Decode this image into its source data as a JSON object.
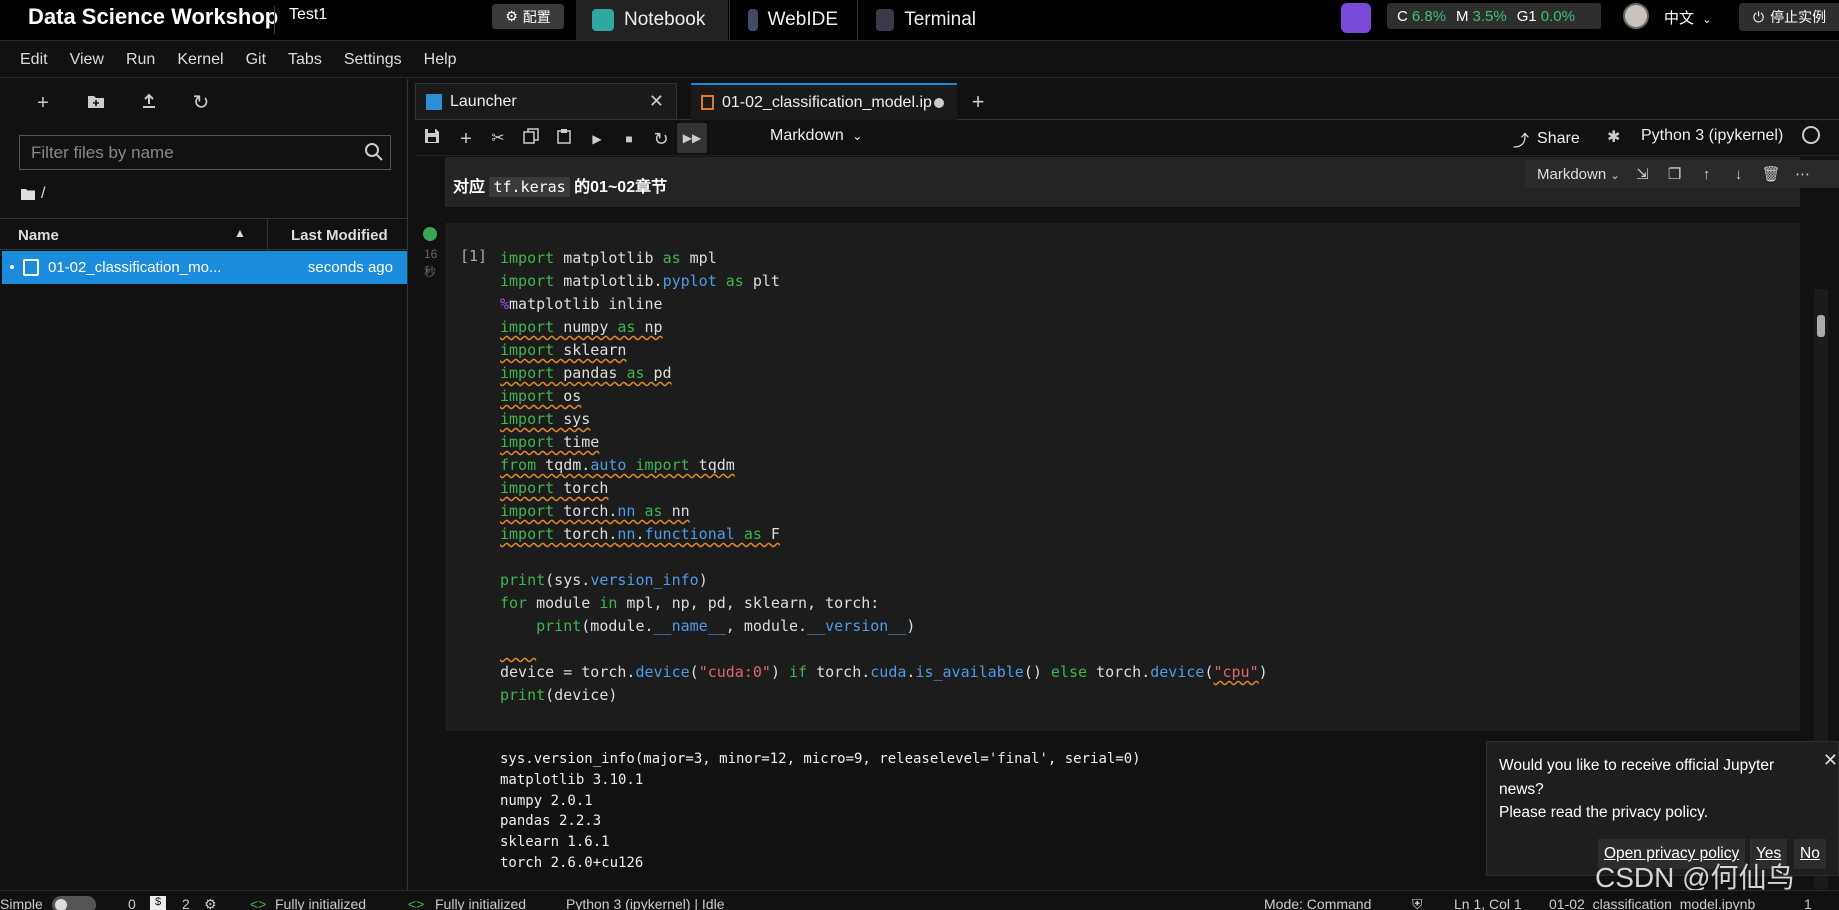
{
  "topbar": {
    "brand": "Data Science Workshop",
    "project": "Test1",
    "config_label": "配置",
    "tabs": [
      {
        "label": "Notebook",
        "icon": "notebook-icon",
        "color": "#2fa8a0"
      },
      {
        "label": "WebIDE",
        "icon": "webide-icon",
        "color": "#444a66"
      },
      {
        "label": "Terminal",
        "icon": "terminal-icon",
        "color": "#3a3a4a"
      }
    ],
    "resources": [
      {
        "label": "C",
        "value": "6.8%"
      },
      {
        "label": "M",
        "value": "3.5%"
      },
      {
        "label": "G1",
        "value": "0.0%"
      }
    ],
    "language": "中文",
    "stop_label": "停止实例"
  },
  "menu": [
    "Edit",
    "View",
    "Run",
    "Kernel",
    "Git",
    "Tabs",
    "Settings",
    "Help"
  ],
  "sidebar": {
    "filter_placeholder": "Filter files by name",
    "breadcrumb": "/",
    "col_name": "Name",
    "col_modified": "Last Modified",
    "files": [
      {
        "name": "01-02_classification_mo...",
        "modified": "seconds ago"
      }
    ]
  },
  "tabs": {
    "launcher": "Launcher",
    "notebook": "01-02_classification_model.ip"
  },
  "toolbar": {
    "cell_type": "Markdown",
    "share": "Share",
    "kernel": "Python 3 (ipykernel)"
  },
  "cell_toolbar": {
    "cell_type": "Markdown"
  },
  "markdown_cell": {
    "prefix": "对应 ",
    "code": "tf.keras",
    "suffix": " 的01~02章节"
  },
  "code_cell": {
    "prompt": "[1]",
    "time": "16",
    "time_unit": "秒"
  },
  "output": [
    "sys.version_info(major=3, minor=12, micro=9, releaselevel='final', serial=0)",
    "matplotlib 3.10.1",
    "numpy 2.0.1",
    "pandas 2.2.3",
    "sklearn 1.6.1",
    "torch 2.6.0+cu126"
  ],
  "notification": {
    "question": "Would you like to receive official Jupyter news?",
    "policy": "Please read the privacy policy.",
    "open_policy": "Open privacy policy",
    "yes": "Yes",
    "no": "No"
  },
  "watermark": "CSDN @何仙鸟",
  "status": {
    "mode_label": "Simple",
    "terminals": "0",
    "kernels": "2",
    "init1": "Fully initialized",
    "init2": "Fully initialized",
    "kernel_state": "Python 3 (ipykernel) | Idle",
    "mode": "Mode: Command",
    "position": "Ln 1, Col 1",
    "file": "01-02_classification_model.ipynb",
    "count": "1"
  },
  "colors": {
    "accent": "#1a8cdb",
    "keyword": "#3fb54f",
    "attribute": "#4d9ce8",
    "magic": "#b44de8",
    "string": "#e06767",
    "resource_value": "#3fc26c"
  }
}
